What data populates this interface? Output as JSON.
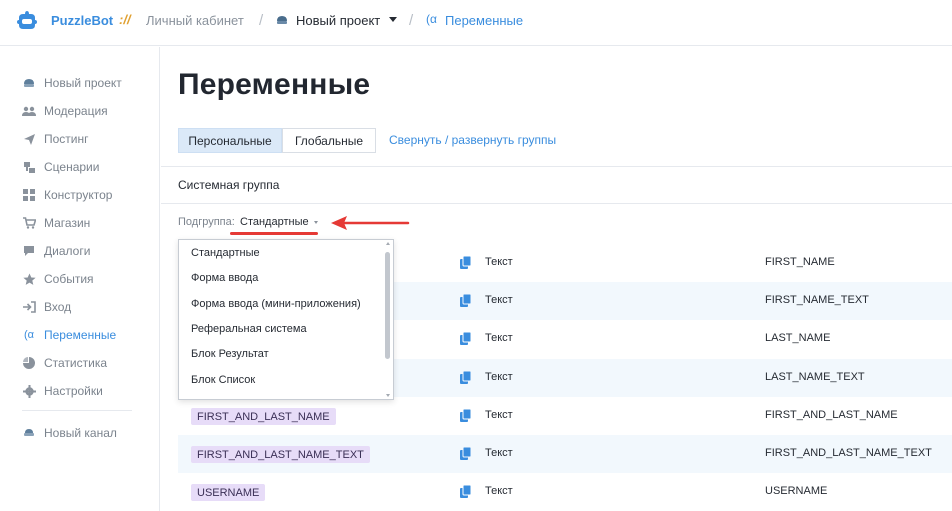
{
  "header": {
    "brand": "PuzzleBot",
    "brand_separator": "://",
    "cabinet": "Личный кабинет",
    "project": "Новый проект",
    "variables": "Переменные"
  },
  "sidebar": {
    "items": [
      {
        "label": "Новый проект",
        "icon": "project-icon"
      },
      {
        "label": "Модерация",
        "icon": "users-icon"
      },
      {
        "label": "Постинг",
        "icon": "send-icon"
      },
      {
        "label": "Сценарии",
        "icon": "scenario-icon"
      },
      {
        "label": "Конструктор",
        "icon": "grid-icon"
      },
      {
        "label": "Магазин",
        "icon": "cart-icon"
      },
      {
        "label": "Диалоги",
        "icon": "chat-icon"
      },
      {
        "label": "События",
        "icon": "star-icon"
      },
      {
        "label": "Вход",
        "icon": "login-icon"
      },
      {
        "label": "Переменные",
        "icon": "variables-icon",
        "active": true
      },
      {
        "label": "Статистика",
        "icon": "chart-icon"
      },
      {
        "label": "Настройки",
        "icon": "gear-icon"
      }
    ],
    "new_channel": "Новый канал"
  },
  "main": {
    "title": "Переменные",
    "tabs": [
      "Персональные",
      "Глобальные"
    ],
    "toggle_groups": "Свернуть / развернуть группы",
    "system_group": "Системная группа",
    "subgroup_label": "Подгруппа:",
    "subgroup_value": "Стандартные"
  },
  "dropdown": {
    "options": [
      "Стандартные",
      "Форма ввода",
      "Форма ввода (мини-приложения)",
      "Реферальная система",
      "Блок Результат",
      "Блок Список"
    ]
  },
  "rows": [
    {
      "name": "",
      "type": "Текст",
      "code": "FIRST_NAME"
    },
    {
      "name": "",
      "type": "Текст",
      "code": "FIRST_NAME_TEXT"
    },
    {
      "name": "",
      "type": "Текст",
      "code": "LAST_NAME"
    },
    {
      "name": "",
      "type": "Текст",
      "code": "LAST_NAME_TEXT"
    },
    {
      "name": "FIRST_AND_LAST_NAME",
      "type": "Текст",
      "code": "FIRST_AND_LAST_NAME"
    },
    {
      "name": "FIRST_AND_LAST_NAME_TEXT",
      "type": "Текст",
      "code": "FIRST_AND_LAST_NAME_TEXT"
    },
    {
      "name": "USERNAME",
      "type": "Текст",
      "code": "USERNAME"
    }
  ],
  "colors": {
    "accent": "#3a8dde",
    "badge": "#e7dcf8",
    "annotation": "#e53935"
  }
}
